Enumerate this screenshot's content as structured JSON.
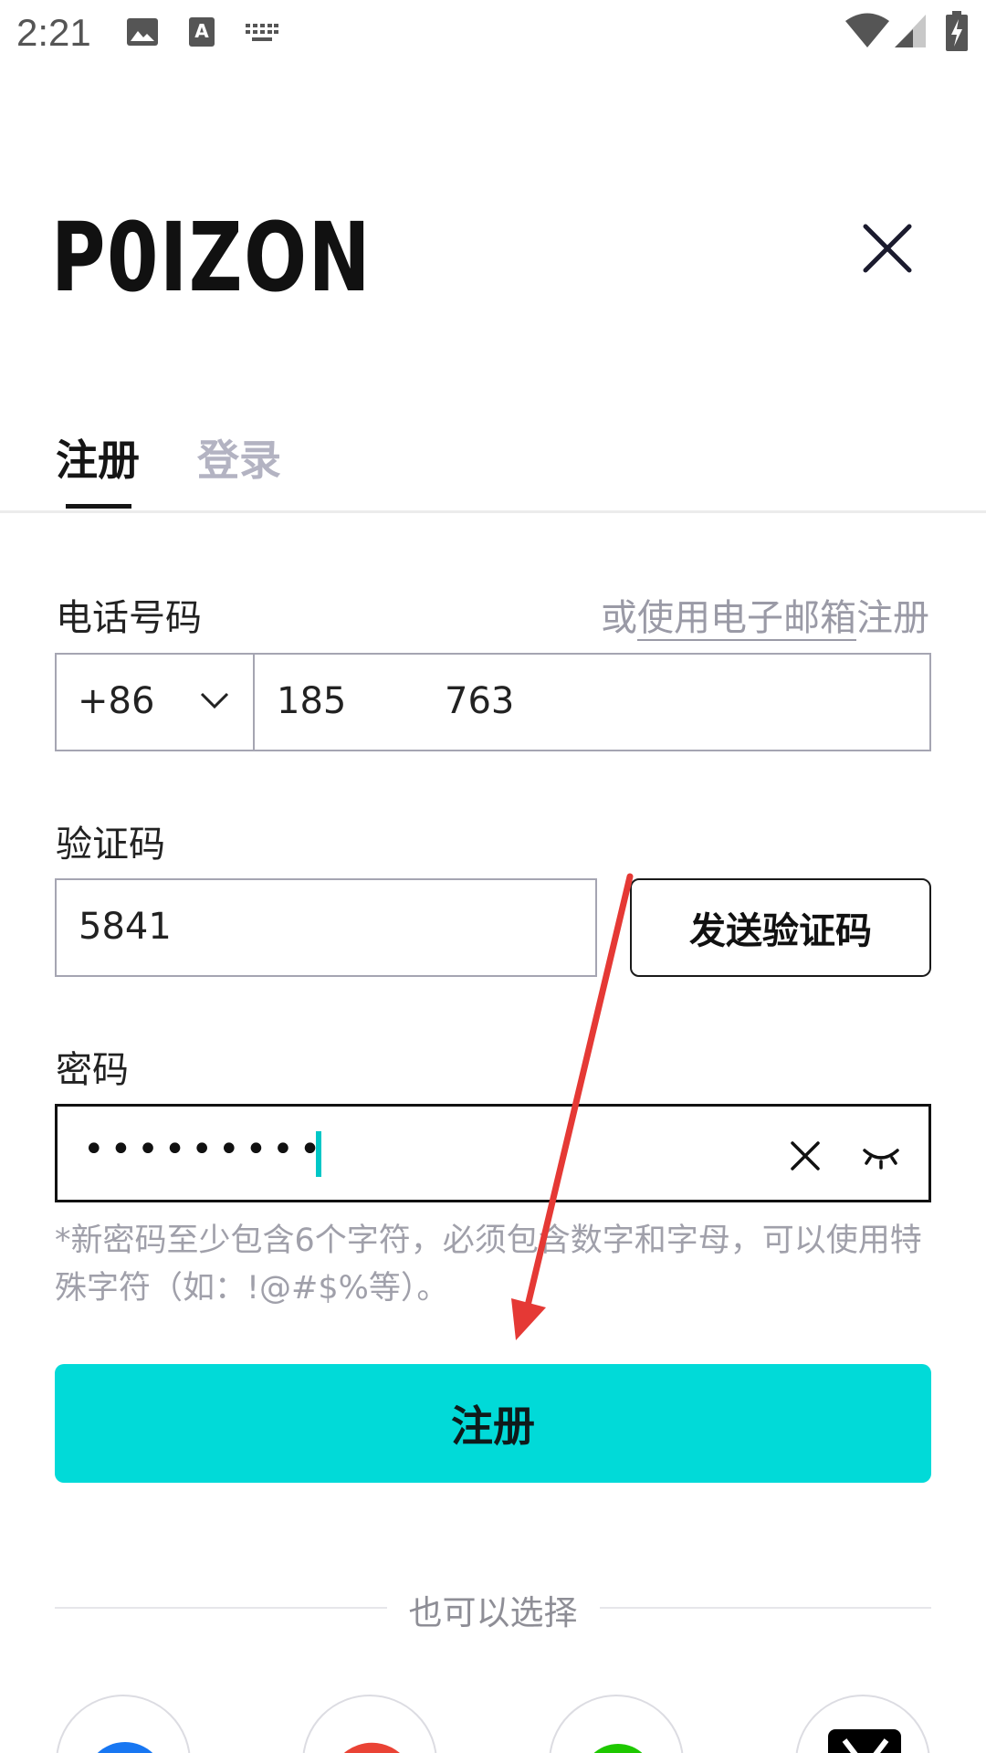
{
  "status_bar": {
    "time": "2:21",
    "icons": [
      "image-icon",
      "text-recognition-icon",
      "keyboard-icon",
      "wifi-icon",
      "signal-icon",
      "battery-charging-icon"
    ]
  },
  "brand": {
    "logo_text": "P0IZON"
  },
  "tabs": {
    "register": "注册",
    "login": "登录",
    "active": "register"
  },
  "phone": {
    "label": "电话号码",
    "alt_prefix": "或",
    "alt_link": "使用电子邮箱",
    "alt_suffix": "注册",
    "country_code": "+86",
    "value_start": "185",
    "value_end": "763"
  },
  "verification": {
    "label": "验证码",
    "value": "5841",
    "send_button": "发送验证码"
  },
  "password": {
    "label": "密码",
    "masked_value": "•••••••••",
    "hint": "*新密码至少包含6个字符，必须包含数字和字母，可以使用特殊字符（如：!@#$%等）。"
  },
  "submit": {
    "label": "注册"
  },
  "alternatives": {
    "divider_text": "也可以选择",
    "providers": [
      "facebook-icon",
      "google-icon",
      "line-icon",
      "x-icon"
    ]
  },
  "colors": {
    "accent": "#01dad8",
    "annotation_arrow": "#e53935",
    "inactive_tab": "#b3b3c2",
    "hint_text": "#a0a0aa"
  }
}
